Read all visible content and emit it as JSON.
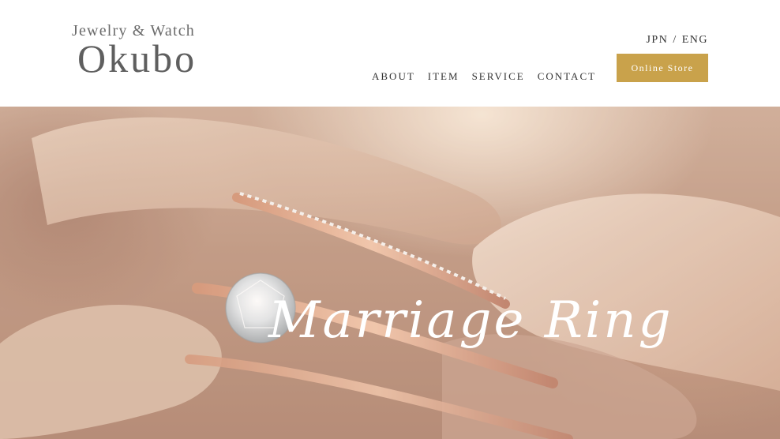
{
  "header": {
    "logo": {
      "tagline": "Jewelry & Watch",
      "brand": "Okubo"
    },
    "nav": [
      {
        "label": "ABOUT"
      },
      {
        "label": "ITEM"
      },
      {
        "label": "SERVICE"
      },
      {
        "label": "CONTACT"
      }
    ],
    "language": {
      "jpn": "JPN",
      "separator": "/",
      "eng": "ENG"
    },
    "online_store_label": "Online Store"
  },
  "hero": {
    "script_title": "Marriage Ring"
  },
  "colors": {
    "accent": "#c9a24b",
    "header_bg": "#ffffff",
    "text": "#333333"
  }
}
